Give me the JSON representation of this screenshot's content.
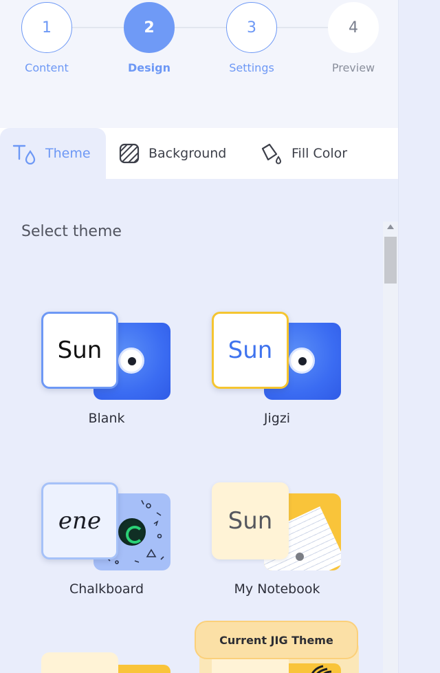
{
  "steps": [
    {
      "number": "1",
      "label": "Content",
      "state": "done"
    },
    {
      "number": "2",
      "label": "Design",
      "state": "active"
    },
    {
      "number": "3",
      "label": "Settings",
      "state": "done"
    },
    {
      "number": "4",
      "label": "Preview",
      "state": "pending"
    }
  ],
  "tabs": [
    {
      "label": "Theme",
      "icon": "text-drop-icon",
      "active": true
    },
    {
      "label": "Background",
      "icon": "hatched-square-icon",
      "active": false
    },
    {
      "label": "Fill Color",
      "icon": "paint-bucket-icon",
      "active": false
    }
  ],
  "section_title": "Select theme",
  "themes": [
    {
      "label": "Blank",
      "preview_text": "Sun"
    },
    {
      "label": "Jigzi",
      "preview_text": "Sun"
    },
    {
      "label": "Chalkboard",
      "preview_text": "ene"
    },
    {
      "label": "My Notebook",
      "preview_text": "Sun"
    }
  ],
  "current_badge": "Current JIG Theme",
  "colors": {
    "accent": "#6d98f5",
    "panel_bg": "#f3f5fc",
    "content_bg": "#e9edfb",
    "jigzi_border": "#f5c530",
    "notebook_yellow": "#f9c43a"
  }
}
